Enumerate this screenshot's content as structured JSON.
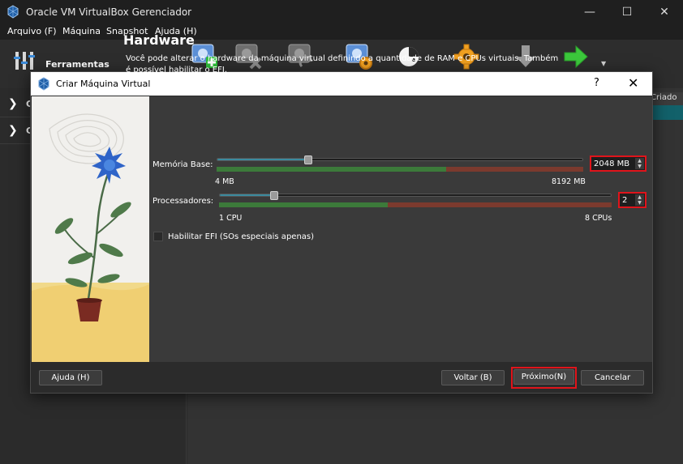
{
  "window": {
    "title": "Oracle VM VirtualBox Gerenciador"
  },
  "menu": [
    {
      "label": "Arquivo (F)"
    },
    {
      "label": "Máquina"
    },
    {
      "label": "Snapshot"
    },
    {
      "label": "Ajuda (H)"
    }
  ],
  "tools": {
    "label": "Ferramentas"
  },
  "sidebar": {
    "items": [
      {
        "label": "G"
      },
      {
        "label": "C"
      }
    ]
  },
  "table": {
    "column_partial": "Criado"
  },
  "dialog": {
    "title": "Criar Máquina Virtual",
    "help_glyph": "?",
    "heading": "Hardware",
    "description": "Você pode alterar o hardware da máquina virtual definindo a quantidade de RAM e CPUs virtuais. Também é possível habilitar o EFI.",
    "memory": {
      "label": "Memória Base:",
      "value": "2048 MB",
      "min_label": "4 MB",
      "max_label": "8192 MB",
      "level": 0.25,
      "recommended_fraction": 0.625
    },
    "processors": {
      "label": "Processadores:",
      "value": "2",
      "min_label": "1 CPU",
      "max_label": "8 CPUs",
      "level": 0.14,
      "recommended_fraction": 0.43
    },
    "efi": {
      "label": "Habilitar EFI (SOs especiais apenas)",
      "checked": false
    },
    "buttons": {
      "help": "Ajuda (H)",
      "back": "Voltar (B)",
      "next": "Próximo(N)",
      "cancel": "Cancelar"
    }
  },
  "colors": {
    "highlight": "#e0141b",
    "slider_fill": "#3b8a9e",
    "range_green": "#3c7a3a",
    "range_red": "#7b3a2e",
    "dialog_bg": "#3a3a3a"
  },
  "icons": [
    "virtualbox-icon",
    "tools-icon",
    "new-vm-icon",
    "remove-vm-icon",
    "discard-icon",
    "settings-icon",
    "start-icon",
    "preferences-icon",
    "import-icon",
    "export-icon"
  ]
}
